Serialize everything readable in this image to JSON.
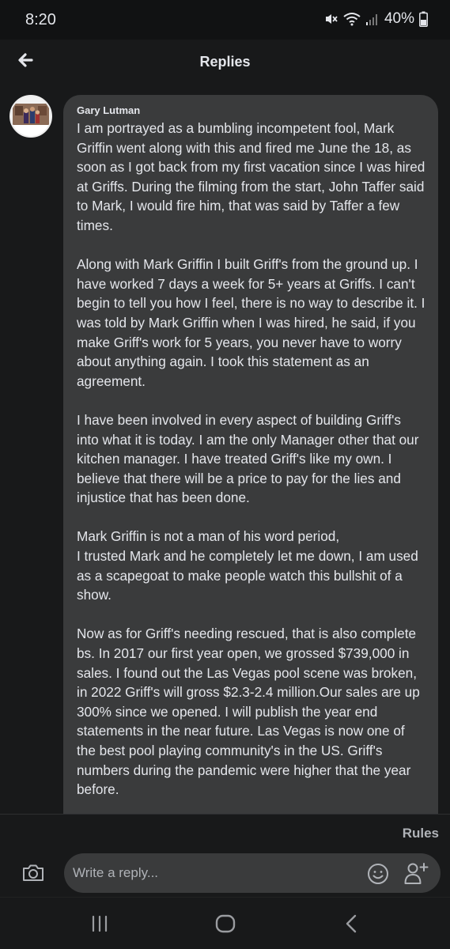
{
  "status_bar": {
    "time": "8:20",
    "battery": "40%"
  },
  "header": {
    "title": "Replies"
  },
  "comment": {
    "author": "Gary Lutman",
    "paragraphs": [
      "I am portrayed as a bumbling incompetent fool, Mark Griffin went along with this and fired me June the 18, as soon as I got back from my first vacation since I was hired at Griffs. During the filming from the start, John Taffer said to Mark, I would fire him, that was said by Taffer a few times.",
      "Along with Mark Griffin I built Griff's from the ground up. I have worked 7 days a week for 5+ years at Griffs. I can't begin to tell you how I feel, there is no way to describe it. I was told by Mark Griffin when I was hired, he said, if you make Griff's work for 5 years, you never have to worry about anything again. I took this statement as an agreement.",
      "I have been involved in every aspect of building Griff's into what it is today. I am the only Manager other that our kitchen manager. I have treated Griff's like my own. I believe that there will be a price to pay for the lies and injustice that has been done.",
      "Mark Griffin is not a man of his word period,\nI trusted Mark and he completely let me down, I am used as a scapegoat to make people watch this bullshit of a show.",
      "Now as for Griff's needing rescued, that is also complete bs. In 2017 our first year open, we grossed $739,000 in sales. I found out the Las Vegas pool scene was broken, in 2022 Griff's will gross $2.3-2.4 million.Our sales are up 300% since we opened. I will publish the year end statements in the near future. Las Vegas is now one of the best pool playing community's in the US. Griff's numbers during the pandemic were higher that the year before."
    ]
  },
  "rules_link": "Rules",
  "composer": {
    "placeholder": "Write a reply..."
  },
  "icons": {
    "back": "arrow-left-icon",
    "camera": "camera-icon",
    "emoji": "smiley-icon",
    "mention": "person-plus-icon"
  },
  "colors": {
    "background": "#18191a",
    "bubble": "#3a3b3c",
    "text": "#e4e6eb",
    "muted": "#b0b3b8"
  }
}
